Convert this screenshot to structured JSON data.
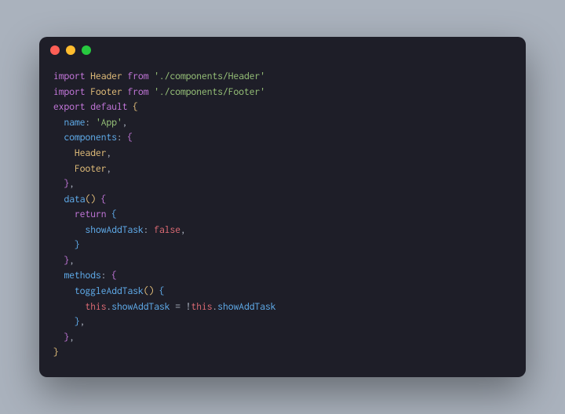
{
  "titlebar": {
    "close": "close",
    "minimize": "minimize",
    "maximize": "maximize"
  },
  "code": {
    "l1": {
      "kw1": "import",
      "cls": "Header",
      "kw2": "from",
      "str": "'./components/Header'"
    },
    "l2": {
      "kw1": "import",
      "cls": "Footer",
      "kw2": "from",
      "str": "'./components/Footer'"
    },
    "l3": {
      "kw1": "export",
      "kw2": "default",
      "br": "{"
    },
    "l4": {
      "indent": "  ",
      "prop": "name",
      "colon": ": ",
      "str": "'App'",
      "comma": ","
    },
    "l5": {
      "indent": "  ",
      "prop": "components",
      "colon": ": ",
      "br": "{"
    },
    "l6": {
      "indent": "    ",
      "cls": "Header",
      "comma": ","
    },
    "l7": {
      "indent": "    ",
      "cls": "Footer",
      "comma": ","
    },
    "l8": {
      "indent": "  ",
      "br": "}",
      "comma": ","
    },
    "l9": {
      "indent": "  ",
      "fn": "data",
      "paren": "()",
      "sp": " ",
      "br": "{"
    },
    "l10": {
      "indent": "    ",
      "kw": "return",
      "sp": " ",
      "br": "{"
    },
    "l11": {
      "indent": "      ",
      "prop": "showAddTask",
      "colon": ": ",
      "val": "false",
      "comma": ","
    },
    "l12": {
      "indent": "    ",
      "br": "}"
    },
    "l13": {
      "indent": "  ",
      "br": "}",
      "comma": ","
    },
    "l14": {
      "indent": "  ",
      "prop": "methods",
      "colon": ": ",
      "br": "{"
    },
    "l15": {
      "indent": "    ",
      "fn": "toggleAddTask",
      "paren": "()",
      "sp": " ",
      "br": "{"
    },
    "l16": {
      "indent": "      ",
      "this1": "this",
      "dot1": ".",
      "prop1": "showAddTask",
      "eq": " = ",
      "bang": "!",
      "this2": "this",
      "dot2": ".",
      "prop2": "showAddTask"
    },
    "l17": {
      "indent": "    ",
      "br": "}",
      "comma": ","
    },
    "l18": {
      "indent": "  ",
      "br": "}",
      "comma": ","
    },
    "l19": {
      "br": "}"
    }
  }
}
